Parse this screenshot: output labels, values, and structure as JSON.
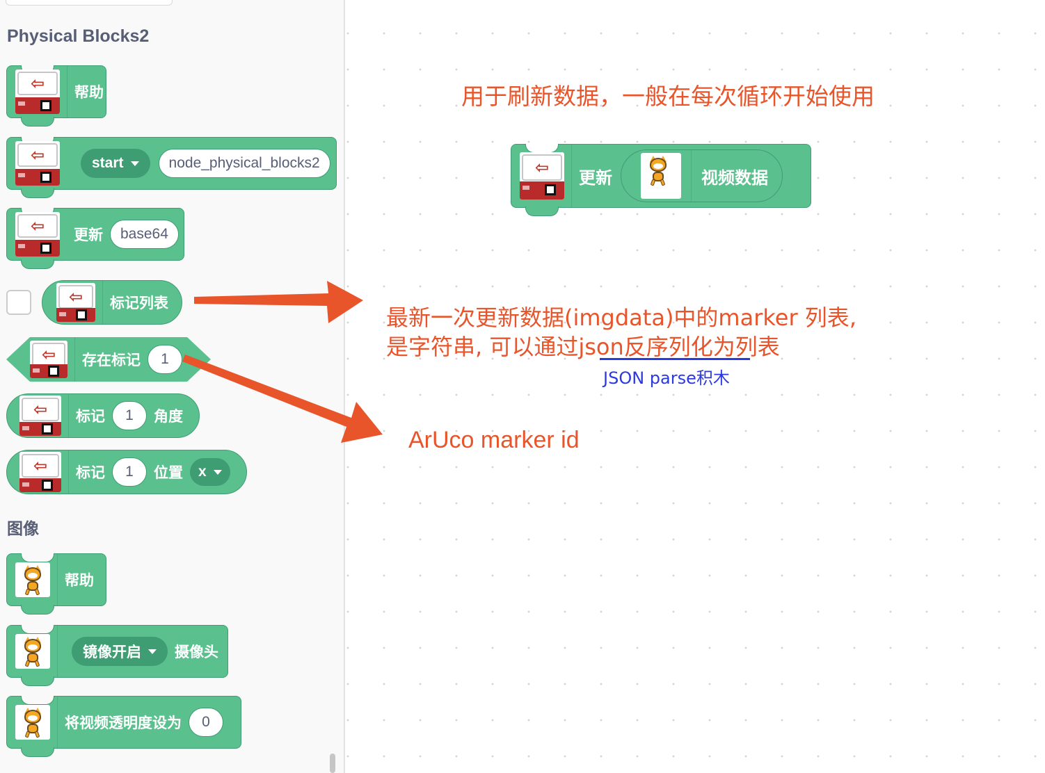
{
  "palette": {
    "physical_category": "Physical Blocks2",
    "image_category": "图像",
    "blocks": {
      "help": "帮助",
      "start_dropdown": "start",
      "start_input": "node_physical_blocks2",
      "update_label": "更新",
      "update_input": "base64",
      "marker_list": "标记列表",
      "has_marker": "存在标记",
      "has_marker_value": "1",
      "marker_label": "标记",
      "marker_angle_value": "1",
      "angle_label": "角度",
      "marker_pos_value": "1",
      "position_label": "位置",
      "position_dropdown": "x",
      "image_help": "帮助",
      "mirror_dropdown": "镜像开启",
      "camera_label": "摄像头",
      "video_transparency": "将视频透明度设为",
      "video_transparency_value": "0"
    }
  },
  "workspace": {
    "block_update": "更新",
    "block_video_data": "视频数据"
  },
  "annotations": {
    "note_refresh": "用于刷新数据，一般在每次循环开始使用",
    "note_marker_list_line1": "最新一次更新数据(imgdata)中的marker 列表,",
    "note_marker_list_line2": "是字符串, 可以通过json反序列化为列表",
    "note_json_parse": "JSON parse积木",
    "note_aruco": "ArUco marker id"
  },
  "colors": {
    "block_green": "#59c08e",
    "block_border": "#3f9d73",
    "annotation_orange": "#e8552b",
    "annotation_blue": "#2b3ae0",
    "icon_red": "#b92b2b"
  },
  "icons": [
    "arrow-left-icon",
    "scratch-cat-icon",
    "dropdown-caret-icon",
    "arrow-icon"
  ]
}
